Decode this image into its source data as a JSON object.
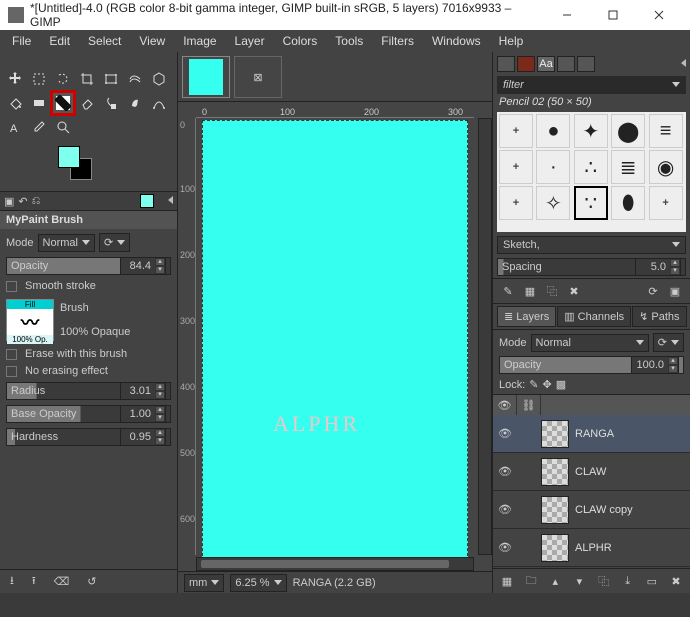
{
  "window": {
    "title": "*[Untitled]-4.0 (RGB color 8-bit gamma integer, GIMP built-in sRGB, 5 layers) 7016x9933 – GIMP"
  },
  "menus": [
    "File",
    "Edit",
    "Select",
    "View",
    "Image",
    "Layer",
    "Colors",
    "Tools",
    "Filters",
    "Windows",
    "Help"
  ],
  "tool_options": {
    "title": "MyPaint Brush",
    "mode_label": "Mode",
    "mode_value": "Normal",
    "opacity_label": "Opacity",
    "opacity_value": "84.4",
    "smooth_label": "Smooth stroke",
    "brush_label": "Brush",
    "brush_caption_top": "Fill",
    "brush_caption_bottom": "100% Op.",
    "brush_name": "100% Opaque",
    "erase_label": "Erase with this brush",
    "no_erase_label": "No erasing effect",
    "radius_label": "Radius",
    "radius_value": "3.01",
    "base_op_label": "Base Opacity",
    "base_op_value": "1.00",
    "hardness_label": "Hardness",
    "hardness_value": "0.95"
  },
  "canvas": {
    "ruler_marks_h": [
      "0",
      "100",
      "200",
      "300"
    ],
    "ruler_marks_v": [
      "0",
      "100",
      "200",
      "300",
      "400",
      "500",
      "600"
    ],
    "watermark": "ALPHR"
  },
  "status": {
    "unit": "mm",
    "zoom": "6.25 %",
    "info": "RANGA (2.2 GB)"
  },
  "brushes": {
    "filter_placeholder": "filter",
    "current": "Pencil 02 (50 × 50)",
    "tag_selected": "Sketch,",
    "spacing_label": "Spacing",
    "spacing_value": "5.0"
  },
  "layer_panel": {
    "tabs": {
      "layers": "Layers",
      "channels": "Channels",
      "paths": "Paths"
    },
    "mode_label": "Mode",
    "mode_value": "Normal",
    "opacity_label": "Opacity",
    "opacity_value": "100.0",
    "lock_label": "Lock:",
    "layers": [
      {
        "name": "RANGA",
        "active": true
      },
      {
        "name": "CLAW",
        "active": false
      },
      {
        "name": "CLAW copy",
        "active": false
      },
      {
        "name": "ALPHR",
        "active": false
      }
    ]
  }
}
